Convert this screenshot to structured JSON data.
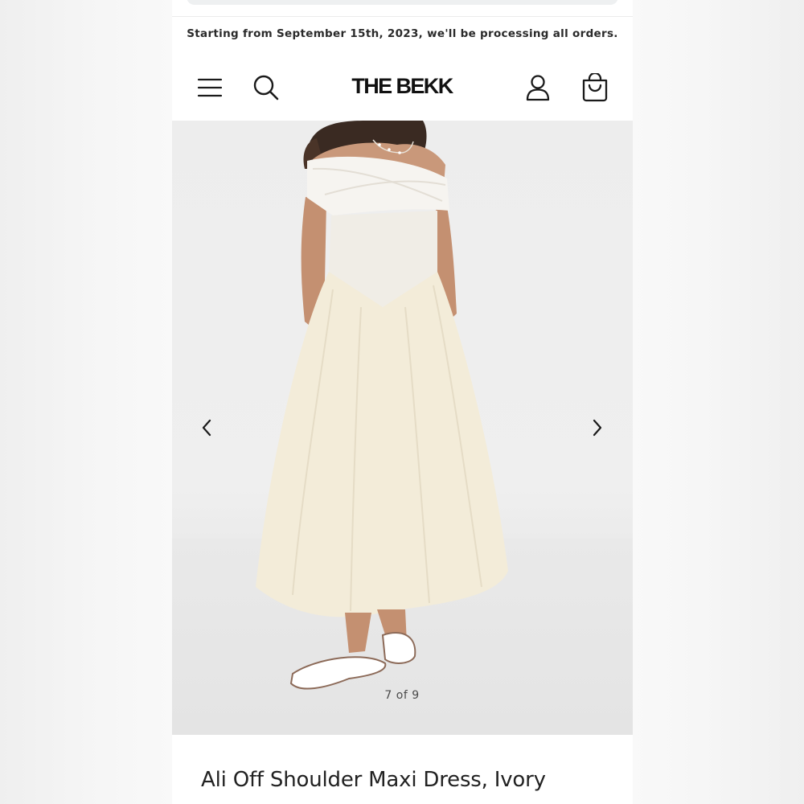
{
  "announcement": {
    "text": "Starting from September 15th, 2023, we'll be processing all orders."
  },
  "header": {
    "logo": "THE BEKK",
    "icons": {
      "menu": "hamburger-menu-icon",
      "search": "search-icon",
      "account": "user-icon",
      "cart": "shopping-bag-icon"
    }
  },
  "gallery": {
    "counter": "7 of 9",
    "current_index": 7,
    "total": 9,
    "icons": {
      "prev": "chevron-left-icon",
      "next": "chevron-right-icon"
    }
  },
  "product": {
    "title": "Ali Off Shoulder Maxi Dress, Ivory"
  },
  "colors": {
    "accent": "#111111",
    "dress": "#f3ecd9",
    "bodice": "#f6f4ef",
    "background": "#ededed"
  }
}
